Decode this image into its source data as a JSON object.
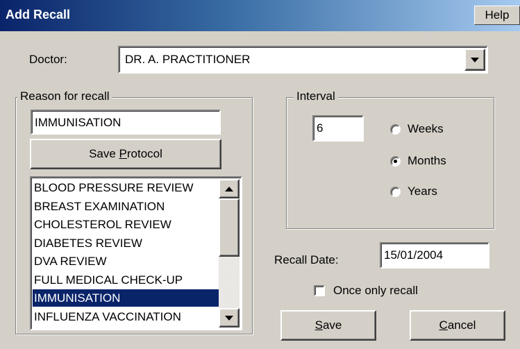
{
  "window": {
    "title": "Add Recall",
    "help_label": "Help"
  },
  "doctor": {
    "label": "Doctor:",
    "value": "DR. A. PRACTITIONER"
  },
  "reason": {
    "group_label": "Reason for recall",
    "input_value": "IMMUNISATION",
    "save_protocol_prefix": "Save ",
    "save_protocol_mnemonic": "P",
    "save_protocol_suffix": "rotocol",
    "list_items": [
      "BLOOD PRESSURE REVIEW",
      "BREAST EXAMINATION",
      "CHOLESTEROL REVIEW",
      "DIABETES REVIEW",
      "DVA REVIEW",
      "FULL MEDICAL CHECK-UP",
      "IMMUNISATION",
      "INFLUENZA VACCINATION"
    ],
    "selected_index": 6
  },
  "interval": {
    "group_label": "Interval",
    "value": "6",
    "weeks_label": "Weeks",
    "months_label": "Months",
    "years_label": "Years",
    "selected": "Months"
  },
  "recall_date": {
    "label": "Recall Date:",
    "value": "15/01/2004"
  },
  "once_only": {
    "label": "Once only recall",
    "checked": false
  },
  "buttons": {
    "save_mnemonic": "S",
    "save_rest": "ave",
    "cancel_mnemonic": "C",
    "cancel_rest": "ancel"
  },
  "colors": {
    "selection": "#0a246a",
    "face": "#d4d0c8",
    "title_start": "#0a246a",
    "title_end": "#a6caf0"
  }
}
